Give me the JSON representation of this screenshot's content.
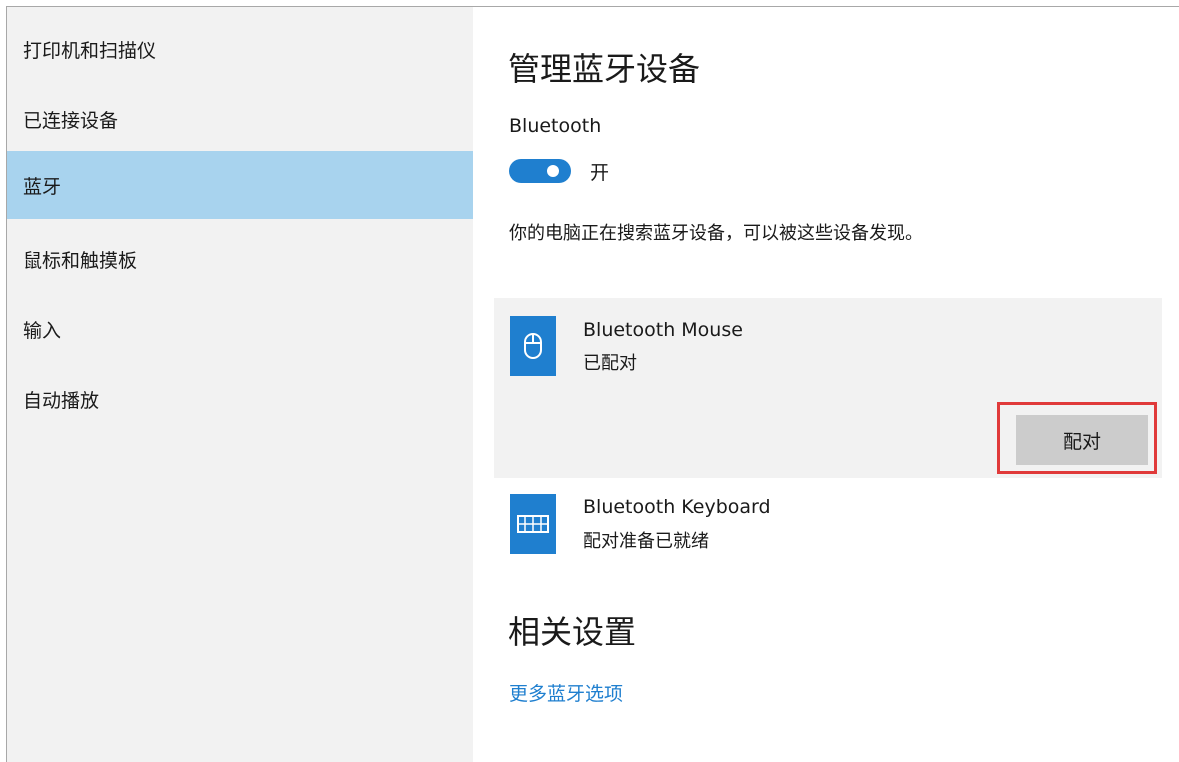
{
  "sidebar": {
    "items": [
      {
        "label": "打印机和扫描仪"
      },
      {
        "label": "已连接设备"
      },
      {
        "label": "蓝牙"
      },
      {
        "label": "鼠标和触摸板"
      },
      {
        "label": "输入"
      },
      {
        "label": "自动播放"
      }
    ],
    "selected_index": 2,
    "selected_color": "#a8d3ee"
  },
  "main": {
    "title": "管理蓝牙设备",
    "bluetooth_label": "Bluetooth",
    "toggle": {
      "state": "开",
      "on": true,
      "color": "#1f7fcf"
    },
    "status_text": "你的电脑正在搜索蓝牙设备，可以被这些设备发现。",
    "devices": [
      {
        "name": "Bluetooth Mouse",
        "status": "已配对",
        "icon": "mouse-icon",
        "selected": true,
        "action_label": "配对"
      },
      {
        "name": "Bluetooth Keyboard",
        "status": "配对准备已就绪",
        "icon": "keyboard-icon",
        "selected": false
      }
    ],
    "related": {
      "heading": "相关设置",
      "link": "更多蓝牙选项"
    }
  },
  "colors": {
    "accent": "#1f7fcf",
    "highlight_border": "#e03a3a",
    "card_bg": "#f2f2f2",
    "button_bg": "#cccccc"
  }
}
